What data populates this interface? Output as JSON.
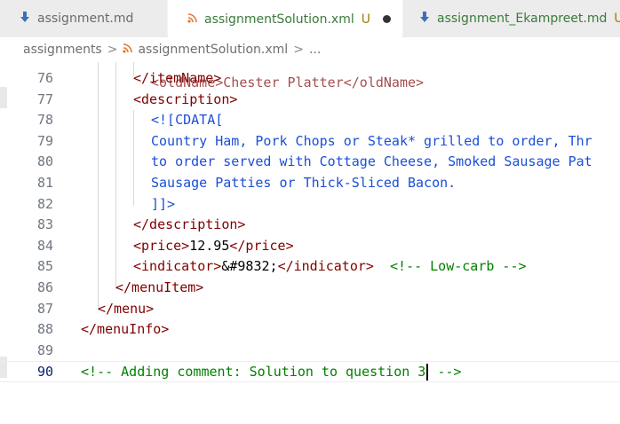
{
  "tabs": [
    {
      "label": "assignment.md",
      "modified": "",
      "icon": "markdown-icon",
      "active": false
    },
    {
      "label": "assignmentSolution.xml",
      "modified": "U",
      "icon": "rss-icon",
      "active": true
    },
    {
      "label": "assignment_Ekampreet.md",
      "modified": "U",
      "icon": "markdown-icon",
      "active": false
    }
  ],
  "breadcrumb": {
    "folder": "assignments",
    "separator": ">",
    "file": "assignmentSolution.xml",
    "more": "..."
  },
  "editor": {
    "top_partial": "<oldName>Chester Platter</oldName>",
    "lines": [
      {
        "num": "76",
        "segments": [
          {
            "t": "</itemName>",
            "c": "tag"
          }
        ]
      },
      {
        "num": "77",
        "segments": [
          {
            "t": "<description>",
            "c": "tag"
          }
        ]
      },
      {
        "num": "78",
        "segments": [
          {
            "t": "<![CDATA[",
            "c": "cdata"
          }
        ]
      },
      {
        "num": "79",
        "segments": [
          {
            "t": "Country Ham, Pork Chops or Steak* grilled to order, Thr",
            "c": "cdata"
          }
        ]
      },
      {
        "num": "80",
        "segments": [
          {
            "t": "to order served with Cottage Cheese, Smoked Sausage Pat",
            "c": "cdata"
          }
        ]
      },
      {
        "num": "81",
        "segments": [
          {
            "t": "Sausage Patties or Thick-Sliced Bacon.",
            "c": "cdata"
          }
        ]
      },
      {
        "num": "82",
        "segments": [
          {
            "t": "]]>",
            "c": "cdata"
          }
        ]
      },
      {
        "num": "83",
        "segments": [
          {
            "t": "</description>",
            "c": "tag"
          }
        ]
      },
      {
        "num": "84",
        "segments": [
          {
            "t": "<price>",
            "c": "tag"
          },
          {
            "t": "12.95",
            "c": "text"
          },
          {
            "t": "</price>",
            "c": "tag"
          }
        ]
      },
      {
        "num": "85",
        "segments": [
          {
            "t": "<indicator>",
            "c": "tag"
          },
          {
            "t": "&#9832;",
            "c": "text"
          },
          {
            "t": "</indicator>",
            "c": "tag"
          },
          {
            "t": "  ",
            "c": "text"
          },
          {
            "t": "<!-- Low-carb -->",
            "c": "comment"
          }
        ]
      },
      {
        "num": "86",
        "segments": [
          {
            "t": "</menuItem>",
            "c": "tag"
          }
        ]
      },
      {
        "num": "87",
        "segments": [
          {
            "t": "</menu>",
            "c": "tag"
          }
        ]
      },
      {
        "num": "88",
        "segments": [
          {
            "t": "</menuInfo>",
            "c": "tag"
          }
        ]
      },
      {
        "num": "89",
        "segments": []
      },
      {
        "num": "90",
        "segments": [
          {
            "t": "<!-- Adding comment: Solution to question 3",
            "c": "comment"
          },
          {
            "t": "CURSOR",
            "c": "cursor"
          },
          {
            "t": " -->",
            "c": "comment"
          }
        ]
      }
    ]
  }
}
